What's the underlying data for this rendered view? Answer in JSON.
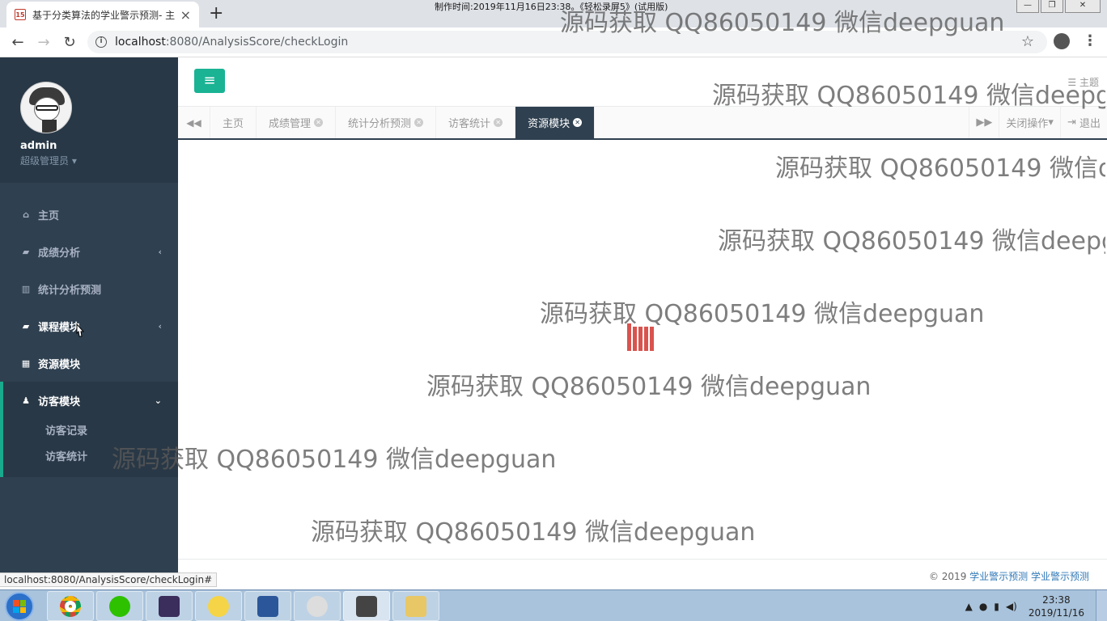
{
  "browser": {
    "tab_title": "基于分类算法的学业警示预测- 主",
    "tab_favicon_text": "15",
    "tab_close": "×",
    "new_tab": "+",
    "url_host": "localhost",
    "url_path": ":8080/AnalysisScore/checkLogin",
    "status_url": "localhost:8080/AnalysisScore/checkLogin#"
  },
  "recording_caption": "制作时间:2019年11月16日23:38。《轻松录屏5》(试用版)",
  "sidebar": {
    "username": "admin",
    "role": "超级管理员",
    "items": [
      {
        "label": "主页",
        "icon": "home-icon"
      },
      {
        "label": "成绩分析",
        "icon": "book-icon"
      },
      {
        "label": "统计分析预测",
        "icon": "bar-chart-icon"
      },
      {
        "label": "课程模块",
        "icon": "book-icon"
      },
      {
        "label": "资源模块",
        "icon": "table-icon"
      },
      {
        "label": "访客模块",
        "icon": "user-icon"
      }
    ],
    "submenu": [
      "访客记录",
      "访客统计"
    ]
  },
  "topbar": {
    "theme_label": "主题"
  },
  "page_tabs": [
    {
      "label": "主页",
      "closable": false
    },
    {
      "label": "成绩管理",
      "closable": true
    },
    {
      "label": "统计分析预测",
      "closable": true
    },
    {
      "label": "访客统计",
      "closable": true
    },
    {
      "label": "资源模块",
      "closable": true,
      "active": true
    }
  ],
  "tab_actions": {
    "close_ops": "关闭操作",
    "logout": "退出"
  },
  "footer": {
    "copyright": "© 2019 ",
    "link1": "学业警示预测",
    "link2": "学业警示预测"
  },
  "watermark": "源码获取 QQ86050149 微信deepguan",
  "taskbar": {
    "time": "23:38",
    "date": "2019/11/16",
    "apps": [
      "chrome-icon",
      "wechat-icon",
      "javaee-ide-icon",
      "paint-icon",
      "word-icon",
      "map-icon",
      "recorder-icon",
      "explorer-icon"
    ]
  },
  "colors": {
    "sidebar_bg": "#2f4050",
    "accent": "#1ab394",
    "loader": "#d9534f"
  }
}
